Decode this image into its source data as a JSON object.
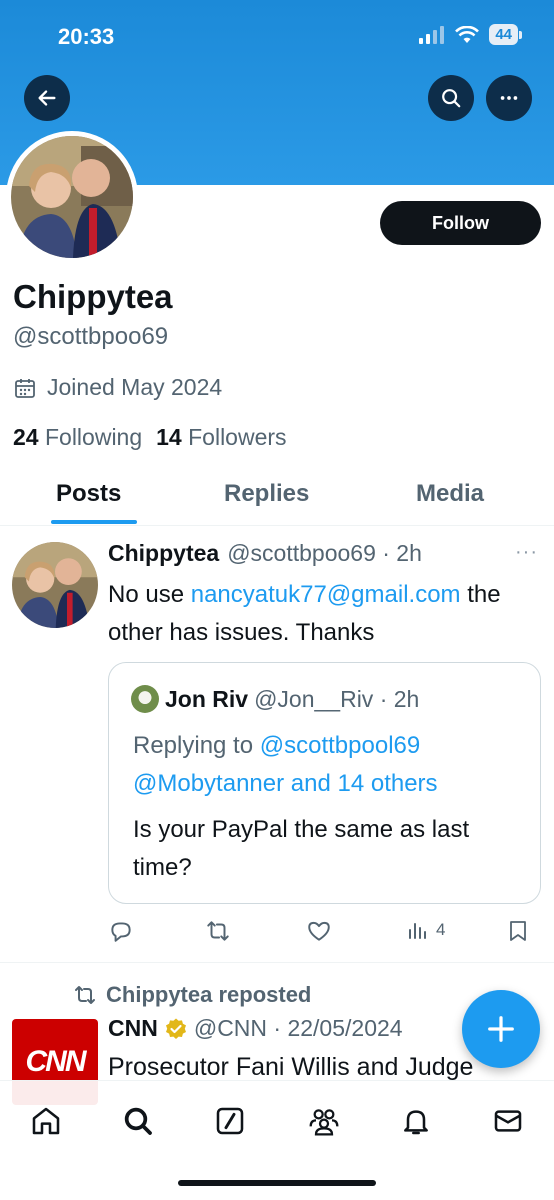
{
  "status_bar": {
    "time": "20:33",
    "battery": "44"
  },
  "profile": {
    "display_name": "Chippytea",
    "handle": "@scottbpoo69",
    "joined": "Joined May 2024",
    "following_count": "24",
    "following_label": "Following",
    "followers_count": "14",
    "followers_label": "Followers",
    "follow_button": "Follow"
  },
  "tabs": [
    {
      "label": "Posts",
      "active": true
    },
    {
      "label": "Replies",
      "active": false
    },
    {
      "label": "Media",
      "active": false
    }
  ],
  "post1": {
    "name": "Chippytea",
    "meta": "@scottbpoo69 · 2h",
    "more": "···",
    "text_before": "No use ",
    "email_link": "nancyatuk77@gmail.com",
    "text_after": " the other has issues.  Thanks",
    "quote": {
      "name": "Jon Riv",
      "meta": "@Jon__Riv · 2h",
      "replying_prefix": "Replying to ",
      "replying_handle": "@scottbpool69",
      "replying_rest": "@Mobytanner and 14 others",
      "text": "Is your PayPal the same as last time?"
    },
    "views": "4"
  },
  "post2": {
    "repost_label": "Chippytea reposted",
    "logo_text": "CNN",
    "name": "CNN",
    "meta": "@CNN · 22/05/2024",
    "text": "Prosecutor Fani Willis and Judge"
  },
  "icons": {
    "back": "arrow-left-icon",
    "search": "search-icon",
    "more": "more-horizontal-icon",
    "calendar": "calendar-icon",
    "reply": "reply-icon",
    "repost": "repost-icon",
    "like": "heart-icon",
    "views": "bar-chart-icon",
    "bookmark": "bookmark-icon",
    "compose": "plus-icon",
    "verified": "verified-badge-icon"
  },
  "colors": {
    "accent": "#1d9bf0",
    "banner": "#1c8ad8",
    "text": "#0f1419",
    "muted": "#536471",
    "cnn_red": "#cc0000",
    "verified_gold": "#e2b719"
  }
}
